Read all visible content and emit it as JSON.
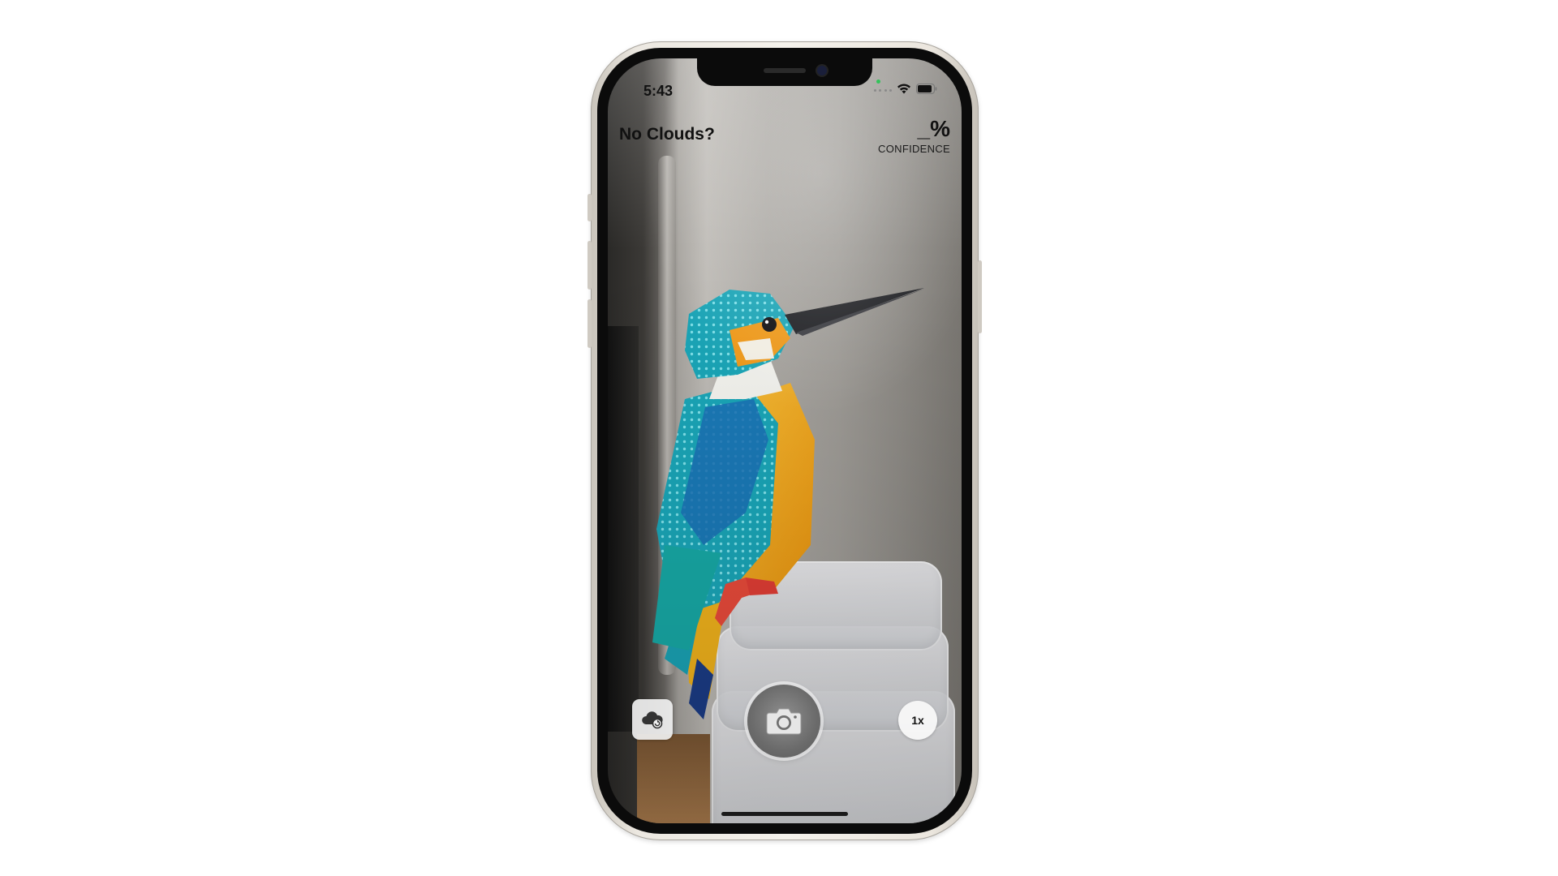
{
  "status_bar": {
    "time": "5:43",
    "icons": [
      "cellular-dots-icon",
      "wifi-icon",
      "battery-icon"
    ]
  },
  "app": {
    "title": "No Clouds?",
    "confidence_value": "_%",
    "confidence_label": "CONFIDENCE"
  },
  "controls": {
    "cloud_button_icon": "cloud-refresh-icon",
    "shutter_icon": "camera-icon",
    "zoom_label": "1x"
  },
  "colors": {
    "text": "#111111",
    "kingfisher_teal": "#19a9b7",
    "kingfisher_orange": "#f3a712"
  }
}
